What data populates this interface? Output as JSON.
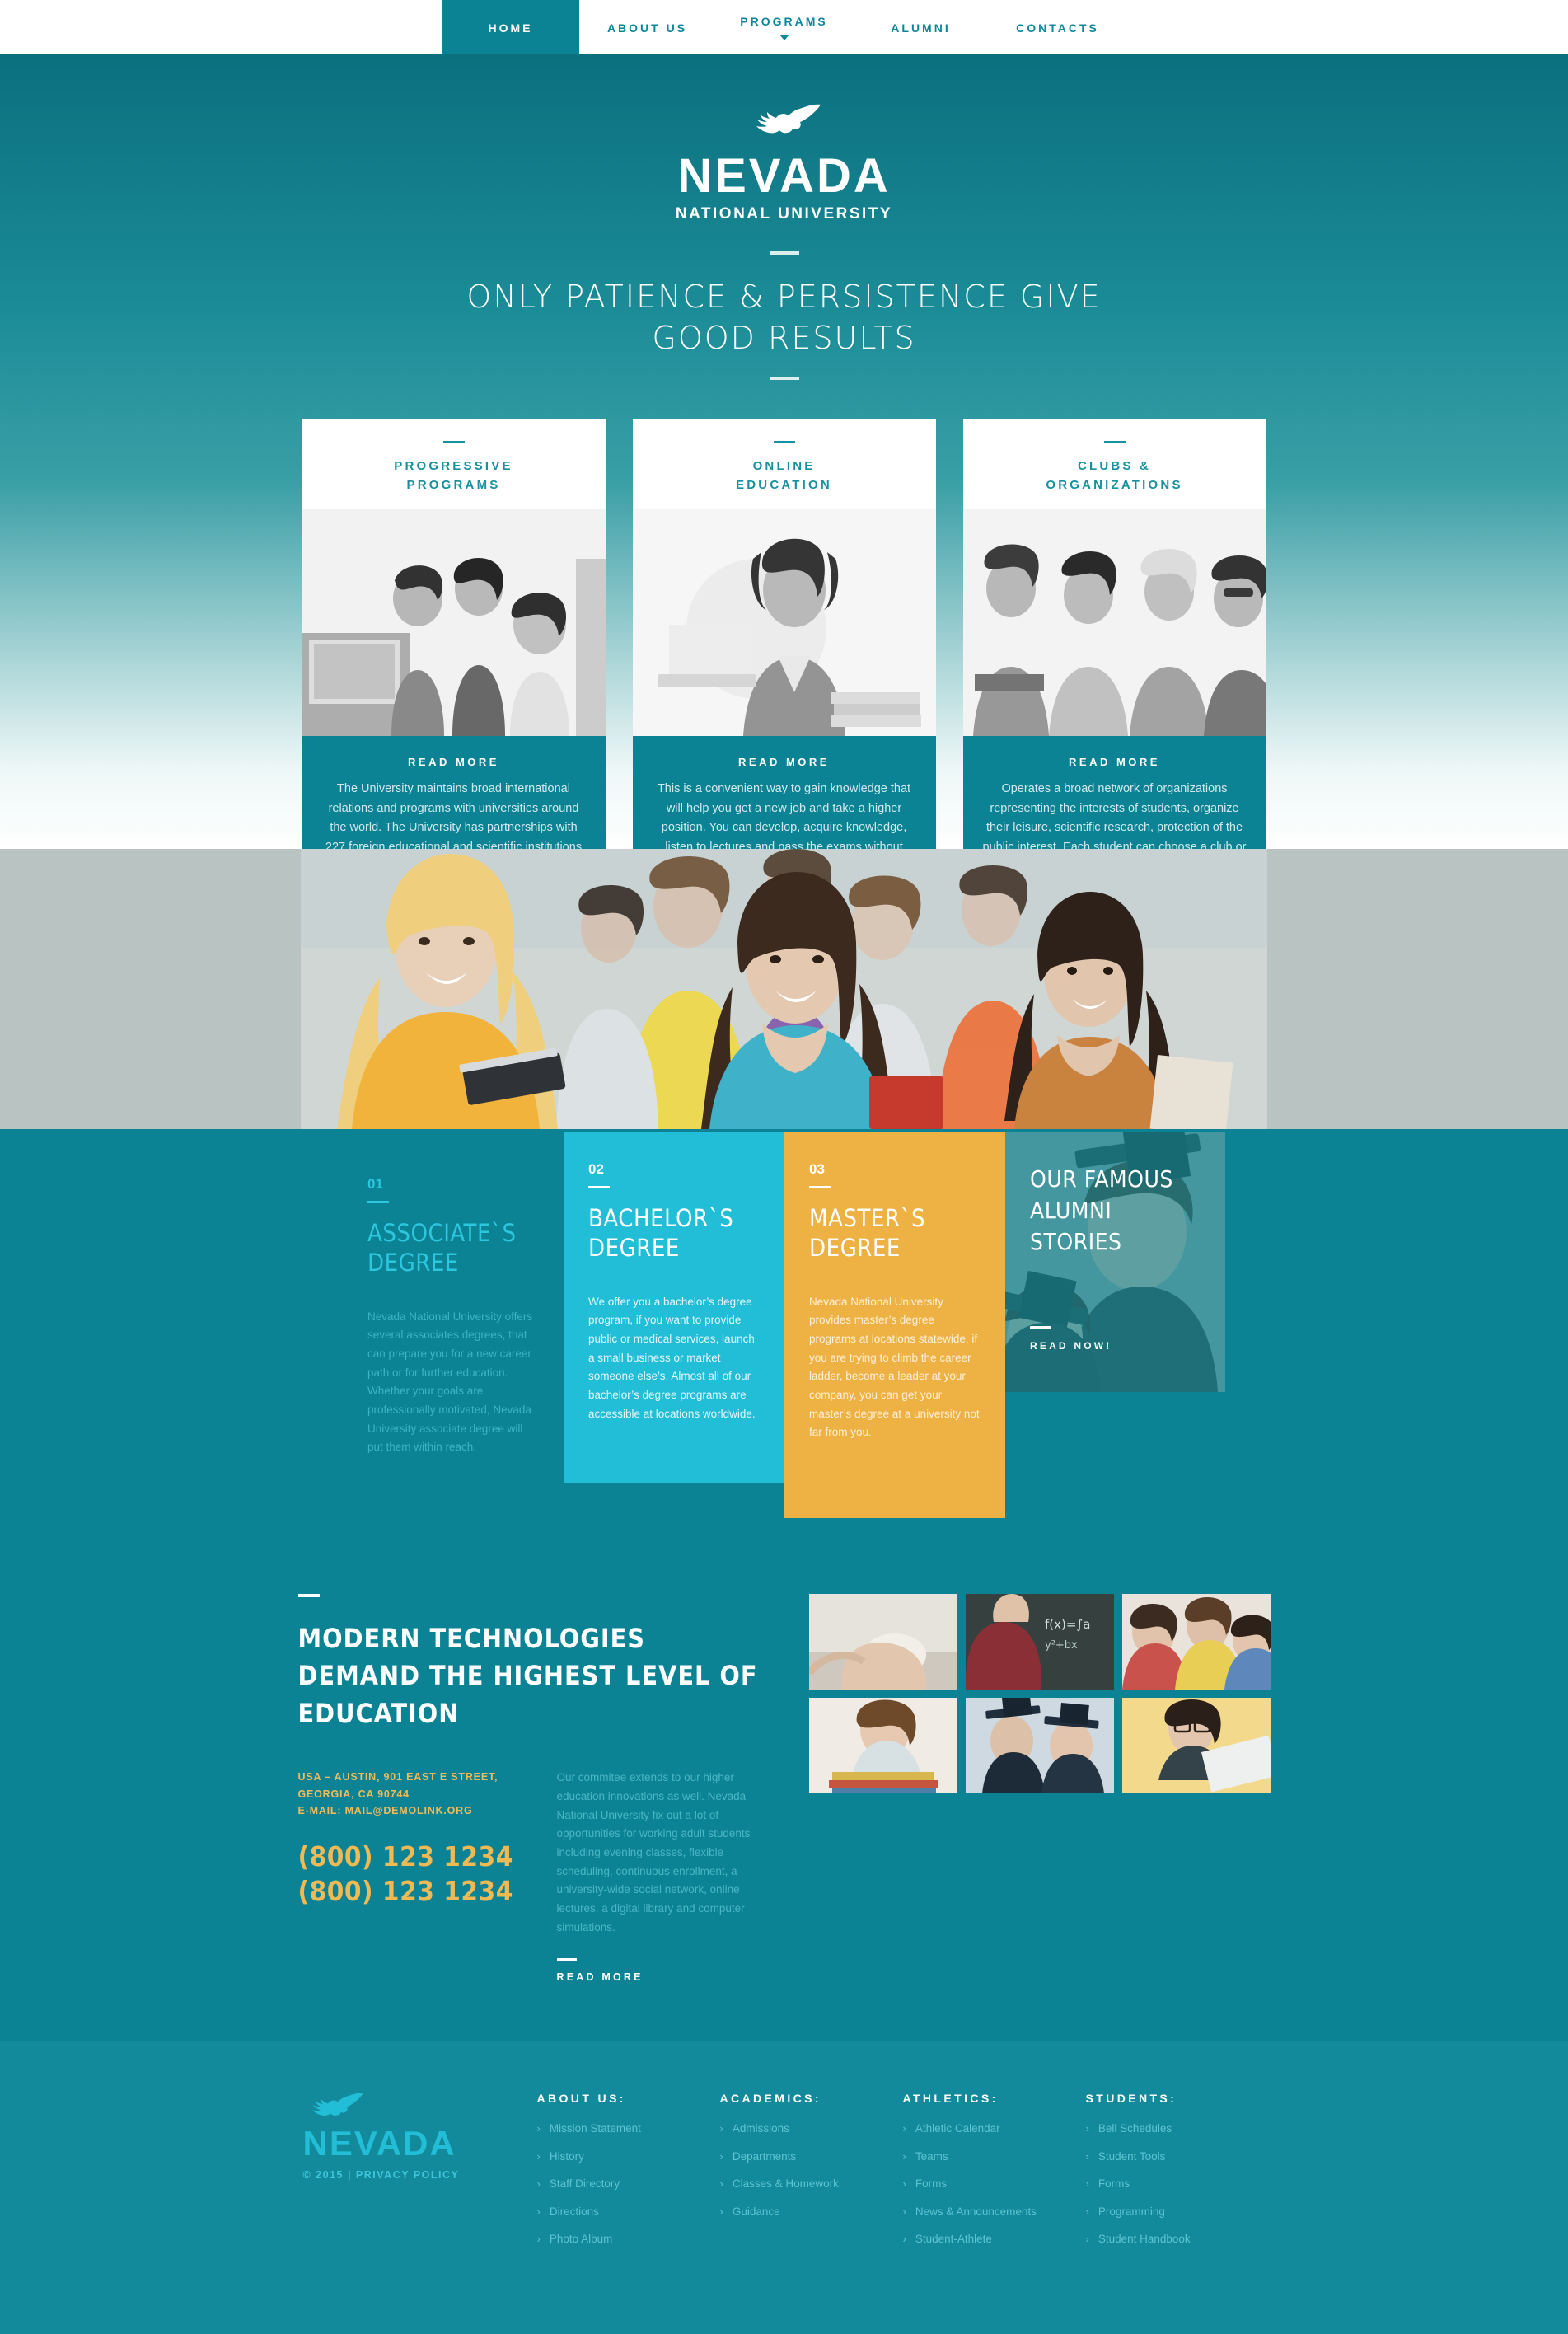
{
  "nav": {
    "items": [
      {
        "label": "HOME",
        "active": true,
        "has_dropdown": false
      },
      {
        "label": "ABOUT US",
        "active": false,
        "has_dropdown": false
      },
      {
        "label": "PROGRAMS",
        "active": false,
        "has_dropdown": true
      },
      {
        "label": "ALUMNI",
        "active": false,
        "has_dropdown": false
      },
      {
        "label": "CONTACTS",
        "active": false,
        "has_dropdown": false
      }
    ]
  },
  "hero": {
    "logo_name": "NEVADA",
    "logo_sub": "NATIONAL UNIVERSITY",
    "tagline_line1": "ONLY PATIENCE & PERSISTENCE GIVE",
    "tagline_line2": "GOOD RESULTS"
  },
  "cards": [
    {
      "title": "PROGRESSIVE\nPROGRAMS",
      "title_l1": "PROGRESSIVE",
      "title_l2": "PROGRAMS",
      "read_more": "READ MORE",
      "text": "The University maintains broad international relations and programs with universities around the world. The University has partnerships with 227 foreign educational and scientific institutions in 57 countries around the world. This gives students the opportunity to gain experience and international communications.",
      "social": [
        "facebook-icon",
        "twitter-icon",
        "linkedin-icon"
      ]
    },
    {
      "title_l1": "ONLINE",
      "title_l2": "EDUCATION",
      "read_more": "READ MORE",
      "text": "This is a convenient way to gain knowledge that will help you get a new job and take a higher position. You can develop, acquire knowledge, listen to lectures and pass the exams without leaving home. Our online system works 24 hours per day, efficiently and without interruption.",
      "social": [
        "facebook-icon",
        "twitter-icon",
        "linkedin-icon"
      ]
    },
    {
      "title_l1": "CLUBS &",
      "title_l2": "ORGANIZATIONS",
      "read_more": "READ MORE",
      "text": "Operates a broad network of organizations representing the interests of students, organize their leisure, scientific research, protection of the public interest. Each student can choose a club or organization that according to his liking. Each organization is a big family of soul mates, which is always looking for new members.",
      "social": [
        "facebook-icon",
        "twitter-icon",
        "linkedin-icon"
      ]
    }
  ],
  "degrees": [
    {
      "number": "01",
      "title_l1": "ASSOCIATE`S",
      "title_l2": "DEGREE",
      "text": "Nevada National University offers several associates degrees, that can prepare you for a new career path or for further education. Whether your goals are  professionally motivated, Nevada University associate degree will put them within reach."
    },
    {
      "number": "02",
      "title_l1": "BACHELOR`S",
      "title_l2": "DEGREE",
      "text": "We offer you a bachelor’s degree program, if you want to provide public or medical services, launch a small business or market someone else’s. Almost all of our bachelor’s degree programs are accessible at locations worldwide."
    },
    {
      "number": "03",
      "title_l1": "MASTER`S",
      "title_l2": "DEGREE",
      "text": "Nevada National University provides master’s degree programs at locations statewide. if you are trying to climb the career ladder, become a leader at your company, you can get your master’s degree at a university not far from you."
    }
  ],
  "alumni": {
    "title_l1": "OUR FAMOUS",
    "title_l2": "ALUMNI",
    "title_l3": "STORIES",
    "cta": "READ NOW!"
  },
  "modern": {
    "title_l1": "MODERN TECHNOLOGIES",
    "title_l2": "DEMAND THE HIGHEST LEVEL OF",
    "title_l3": "EDUCATION",
    "address_l1": "USA – AUSTIN, 901 EAST E STREET,",
    "address_l2": "GEORGIA, CA 90744",
    "email_line": "E-MAIL: MAIL@DEMOLINK.ORG",
    "phone1": "(800) 123 1234",
    "phone2": "(800) 123 1234",
    "paragraph": "Our commitee extends to our higher education innovations as well. Nevada National University fix out a lot of opportunities for working adult students including evening classes, flexible scheduling, continuous enrollment, a university-wide social network, online lectures, a digital library and computer simulations.",
    "read_more": "READ MORE"
  },
  "footer": {
    "brand_name": "NEVADA",
    "copyright": "© 2015 | PRIVACY POLICY",
    "columns": [
      {
        "heading": "ABOUT US:",
        "links": [
          "Mission Statement",
          "History",
          "Staff Directory",
          "Directions",
          "Photo Album"
        ]
      },
      {
        "heading": "ACADEMICS:",
        "links": [
          "Admissions",
          "Departments",
          "Classes & Homework",
          "Guidance"
        ]
      },
      {
        "heading": "ATHLETICS:",
        "links": [
          "Athletic Calendar",
          "Teams",
          "Forms",
          "News & Announcements",
          "Student-Athlete"
        ]
      },
      {
        "heading": "STUDENTS:",
        "links": [
          "Bell Schedules",
          "Student Tools",
          "Forms",
          "Programming",
          "Student Handbook"
        ]
      }
    ]
  },
  "colors": {
    "teal": "#0c8394",
    "teal_dark": "#0a6b78",
    "cyan": "#22bdd6",
    "amber": "#eeb143",
    "footer_teal": "#138a9b"
  }
}
